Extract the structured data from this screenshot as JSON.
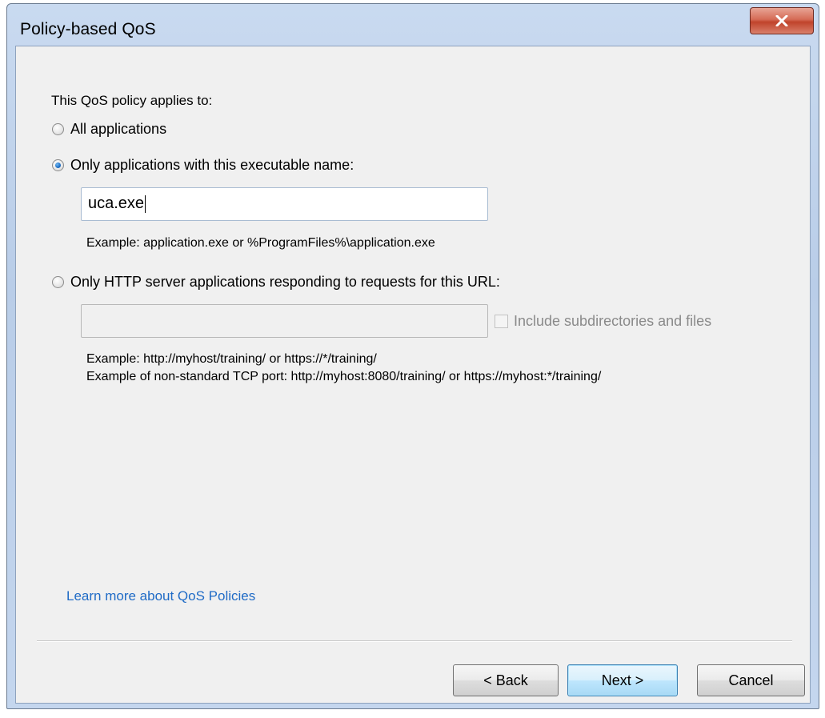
{
  "window": {
    "title": "Policy-based QoS"
  },
  "form": {
    "heading": "This QoS policy applies to:",
    "option_all": "All applications",
    "option_executable": "Only applications with this executable name:",
    "executable_value": "uca.exe",
    "executable_example": "Example:  application.exe or %ProgramFiles%\\application.exe",
    "option_url": "Only HTTP server applications responding to requests for this URL:",
    "url_value": "",
    "include_subdirectories_label": "Include subdirectories and files",
    "url_example_1": "Example:  http://myhost/training/ or https://*/training/",
    "url_example_2": "Example of non-standard TCP port:  http://myhost:8080/training/ or https://myhost:*/training/",
    "selected_option": "executable"
  },
  "footer": {
    "learn_more_link": "Learn more about QoS Policies",
    "back_label": "< Back",
    "next_label": "Next >",
    "cancel_label": "Cancel"
  },
  "colors": {
    "link": "#1f6bc6",
    "close_button": "#c0432b",
    "default_button_border": "#3c7fb1"
  },
  "icons": {
    "close": "close-icon"
  }
}
